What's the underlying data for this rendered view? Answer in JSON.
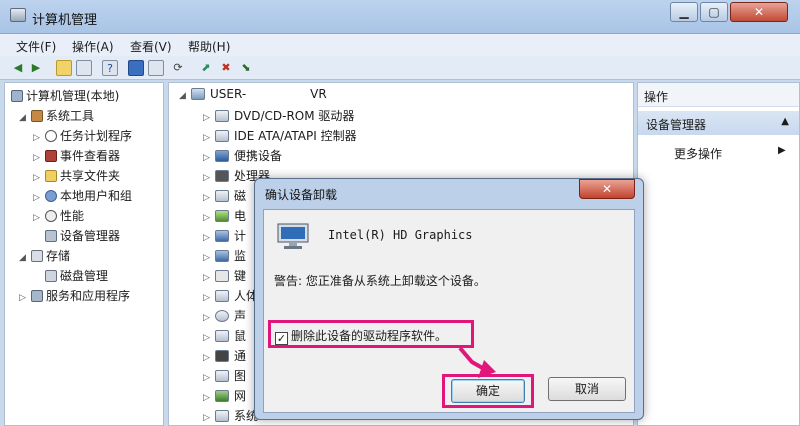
{
  "window": {
    "title": "计算机管理"
  },
  "window_controls": {
    "minimize": "▁",
    "maximize": "▢",
    "close": "✕"
  },
  "menu": [
    "文件(F)",
    "操作(A)",
    "查看(V)",
    "帮助(H)"
  ],
  "toolbar_icons": [
    "back-icon",
    "forward-icon",
    "folder-icon",
    "view-icon",
    "help-icon",
    "properties-icon",
    "scan-icon",
    "update-driver-icon",
    "disable-icon",
    "uninstall-icon"
  ],
  "tree": {
    "root": "计算机管理(本地)",
    "system_tools": "系统工具",
    "task_scheduler": "任务计划程序",
    "event_viewer": "事件查看器",
    "shared_folders": "共享文件夹",
    "local_users": "本地用户和组",
    "performance": "性能",
    "device_manager": "设备管理器",
    "storage": "存储",
    "disk_management": "磁盘管理",
    "services": "服务和应用程序"
  },
  "devices": {
    "computer": "USER-",
    "computer_suffix": "VR",
    "items": [
      "DVD/CD-ROM 驱动器",
      "IDE ATA/ATAPI 控制器",
      "便携设备",
      "处理器",
      "磁",
      "电",
      "计",
      "监",
      "键",
      "人体",
      "声",
      "鼠",
      "通",
      "图",
      "网",
      "系统"
    ]
  },
  "actions": {
    "header": "操作",
    "section": "设备管理器",
    "more": "更多操作"
  },
  "dialog": {
    "title": "确认设备卸载",
    "device": "Intel(R) HD Graphics",
    "warning": "警告: 您正准备从系统上卸载这个设备。",
    "checkbox_label": "删除此设备的驱动程序软件。",
    "checkbox_checked": true,
    "ok": "确定",
    "cancel": "取消"
  },
  "colors": {
    "highlight": "#e2157a",
    "chrome": "#bcd3ee"
  }
}
